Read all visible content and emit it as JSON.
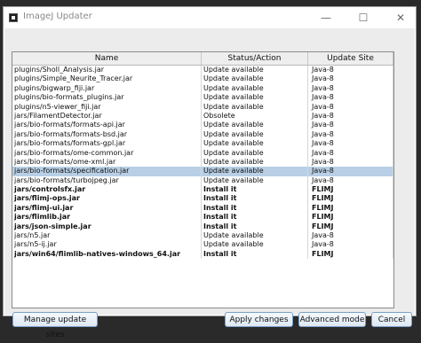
{
  "window": {
    "title": "ImageJ Updater",
    "controls": {
      "minimize": "—",
      "maximize": "☐",
      "close": "✕"
    }
  },
  "table": {
    "headers": [
      "Name",
      "Status/Action",
      "Update Site"
    ],
    "rows": [
      {
        "name": "plugins/Sholl_Analysis.jar",
        "status": "Update available",
        "site": "Java-8",
        "bold": false,
        "selected": false
      },
      {
        "name": "plugins/Simple_Neurite_Tracer.jar",
        "status": "Update available",
        "site": "Java-8",
        "bold": false,
        "selected": false
      },
      {
        "name": "plugins/bigwarp_fiji.jar",
        "status": "Update available",
        "site": "Java-8",
        "bold": false,
        "selected": false
      },
      {
        "name": "plugins/bio-formats_plugins.jar",
        "status": "Update available",
        "site": "Java-8",
        "bold": false,
        "selected": false
      },
      {
        "name": "plugins/n5-viewer_fiji.jar",
        "status": "Update available",
        "site": "Java-8",
        "bold": false,
        "selected": false
      },
      {
        "name": "jars/FilamentDetector.jar",
        "status": "Obsolete",
        "site": "Java-8",
        "bold": false,
        "selected": false
      },
      {
        "name": "jars/bio-formats/formats-api.jar",
        "status": "Update available",
        "site": "Java-8",
        "bold": false,
        "selected": false
      },
      {
        "name": "jars/bio-formats/formats-bsd.jar",
        "status": "Update available",
        "site": "Java-8",
        "bold": false,
        "selected": false
      },
      {
        "name": "jars/bio-formats/formats-gpl.jar",
        "status": "Update available",
        "site": "Java-8",
        "bold": false,
        "selected": false
      },
      {
        "name": "jars/bio-formats/ome-common.jar",
        "status": "Update available",
        "site": "Java-8",
        "bold": false,
        "selected": false
      },
      {
        "name": "jars/bio-formats/ome-xml.jar",
        "status": "Update available",
        "site": "Java-8",
        "bold": false,
        "selected": false
      },
      {
        "name": "jars/bio-formats/specification.jar",
        "status": "Update available",
        "site": "Java-8",
        "bold": false,
        "selected": true
      },
      {
        "name": "jars/bio-formats/turbojpeg.jar",
        "status": "Update available",
        "site": "Java-8",
        "bold": false,
        "selected": false
      },
      {
        "name": "jars/controlsfx.jar",
        "status": "Install it",
        "site": "FLIMJ",
        "bold": true,
        "selected": false
      },
      {
        "name": "jars/flimj-ops.jar",
        "status": "Install it",
        "site": "FLIMJ",
        "bold": true,
        "selected": false
      },
      {
        "name": "jars/flimj-ui.jar",
        "status": "Install it",
        "site": "FLIMJ",
        "bold": true,
        "selected": false
      },
      {
        "name": "jars/flimlib.jar",
        "status": "Install it",
        "site": "FLIMJ",
        "bold": true,
        "selected": false
      },
      {
        "name": "jars/json-simple.jar",
        "status": "Install it",
        "site": "FLIMJ",
        "bold": true,
        "selected": false
      },
      {
        "name": "jars/n5.jar",
        "status": "Update available",
        "site": "Java-8",
        "bold": false,
        "selected": false
      },
      {
        "name": "jars/n5-ij.jar",
        "status": "Update available",
        "site": "Java-8",
        "bold": false,
        "selected": false
      },
      {
        "name": "jars/win64/flimlib-natives-windows_64.jar",
        "status": "Install it",
        "site": "FLIMJ",
        "bold": true,
        "selected": false
      }
    ]
  },
  "buttons": {
    "manage": "Manage update sites",
    "apply": "Apply changes",
    "advanced": "Advanced mode",
    "cancel": "Cancel"
  }
}
